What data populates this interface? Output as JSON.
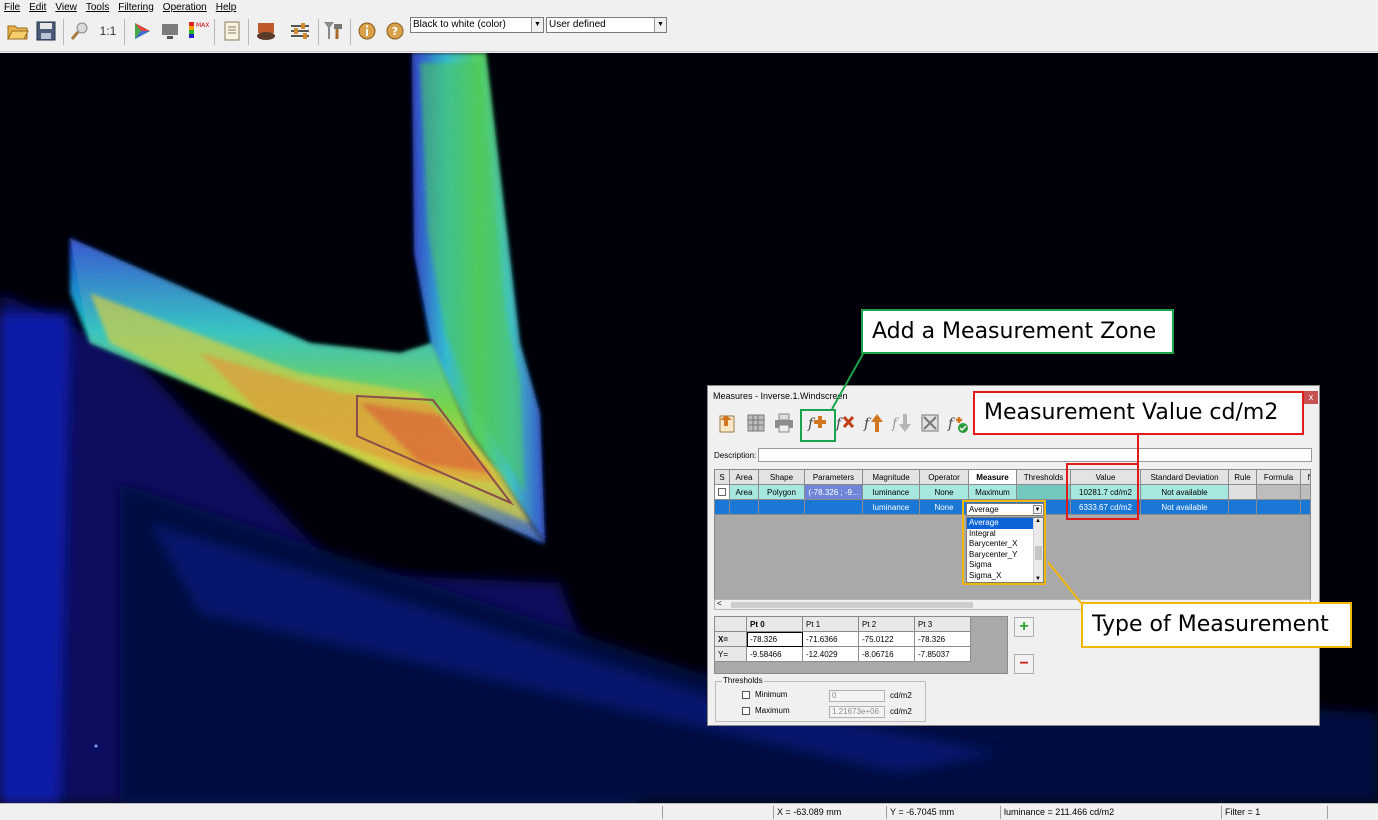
{
  "menu": [
    "File",
    "Edit",
    "View",
    "Tools",
    "Filtering",
    "Operation",
    "Help"
  ],
  "toolbar": {
    "icons": [
      "open-folder-icon",
      "save-icon",
      "zoom-icon",
      "actual-size-icon",
      "color-palette-icon",
      "monitor-icon",
      "color-scale-icon",
      "report-icon",
      "layer-icon",
      "settings-sliders-icon",
      "tools-icon",
      "info-icon",
      "help-icon"
    ],
    "actual_size_label": "1:1",
    "palette_select": "Black to white (color)",
    "scale_select": "User defined"
  },
  "status": {
    "x": "X = -63.089 mm",
    "y": "Y = -6.7045 mm",
    "luminance": "luminance = 211.466 cd/m2",
    "filter": "Filter = 1"
  },
  "dialog": {
    "title": "Measures - Inverse.1.Windscreen",
    "close": "x",
    "tools": [
      "import-icon",
      "grid-icon",
      "print-icon",
      "add-zone-icon",
      "delete-zone-icon",
      "move-up-icon",
      "move-down-icon",
      "fit-icon",
      "validate-icon"
    ],
    "description_label": "Description:",
    "columns": [
      "S",
      "Area",
      "Shape",
      "Parameters",
      "Magnitude",
      "Operator",
      "Measure",
      "Thresholds",
      "Value",
      "Standard Deviation",
      "Rule",
      "Formula",
      "N"
    ],
    "rows": [
      {
        "area": "Area",
        "shape": "Polygon",
        "parameters": "(-78.326 ; -9...",
        "magnitude": "luminance",
        "operator": "None",
        "measure": "Maximum",
        "thresholds": "",
        "value": "10281.7 cd/m2",
        "std_dev": "Not available"
      },
      {
        "area": "",
        "shape": "",
        "parameters": "",
        "magnitude": "luminance",
        "operator": "None",
        "measure": "Average",
        "thresholds": "",
        "value": "6333.67 cd/m2",
        "std_dev": "Not available"
      }
    ],
    "measure_options": [
      "Average",
      "Integral",
      "Barycenter_X",
      "Barycenter_Y",
      "Sigma",
      "Sigma_X"
    ],
    "points": {
      "headers": [
        "Pt 0",
        "Pt 1",
        "Pt 2",
        "Pt 3"
      ],
      "x_label": "X=",
      "y_label": "Y=",
      "x": [
        "-78.326",
        "-71.6366",
        "-75.0122",
        "-78.326"
      ],
      "y": [
        "-9.58466",
        "-12.4029",
        "-8.06716",
        "-7.85037"
      ]
    },
    "thresholds": {
      "legend": "Thresholds",
      "minimum_label": "Minimum",
      "minimum_value": "0",
      "maximum_label": "Maximum",
      "maximum_value": "1.21673e+06",
      "unit": "cd/m2"
    }
  },
  "annotations": {
    "add_zone": "Add a Measurement Zone",
    "value": "Measurement Value cd/m2",
    "type": "Type of Measurement"
  },
  "colors": {
    "green_callout": "#19a34a",
    "red_callout": "#e01b1b",
    "yellow_callout": "#f2b705",
    "selected_row": "#1a77d6",
    "first_row": "#a6e8df"
  }
}
